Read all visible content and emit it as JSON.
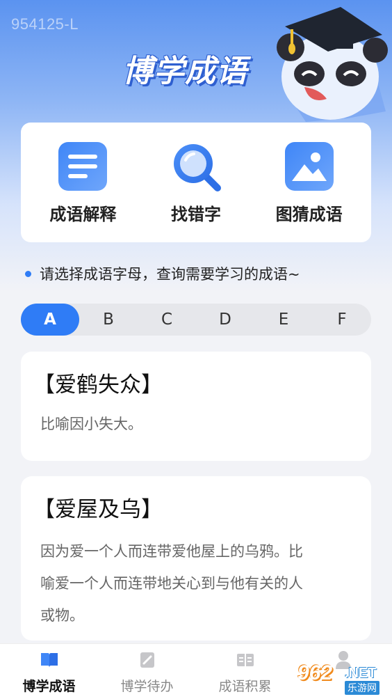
{
  "watermark": "954125-L",
  "header": {
    "title": "博学成语"
  },
  "features": [
    {
      "label": "成语解释",
      "icon": "document-lines-icon"
    },
    {
      "label": "找错字",
      "icon": "magnifier-icon"
    },
    {
      "label": "图猜成语",
      "icon": "picture-icon"
    }
  ],
  "hint": "请选择成语字母，查询需要学习的成语~",
  "letters": [
    "A",
    "B",
    "C",
    "D",
    "E",
    "F"
  ],
  "selected_letter": "A",
  "idioms": [
    {
      "title": "【爱鹤失众】",
      "desc": "比喻因小失大。"
    },
    {
      "title": "【爱屋及乌】",
      "desc_lines": [
        "因为爱一个人而连带爱他屋上的乌鸦。比",
        "喻爱一个人而连带地关心到与他有关的人",
        "或物。"
      ]
    }
  ],
  "tabs": [
    {
      "label": "博学成语",
      "icon": "book-icon",
      "active": true
    },
    {
      "label": "博学待办",
      "icon": "notepad-icon",
      "active": false
    },
    {
      "label": "成语积累",
      "icon": "open-book-icon",
      "active": false
    },
    {
      "label": "",
      "icon": "user-icon",
      "active": false
    }
  ],
  "brand": {
    "num": "962",
    "net": ".NET",
    "sub": "乐游网"
  },
  "colors": {
    "accent": "#2f7cf6",
    "header": "#5b93f0"
  }
}
